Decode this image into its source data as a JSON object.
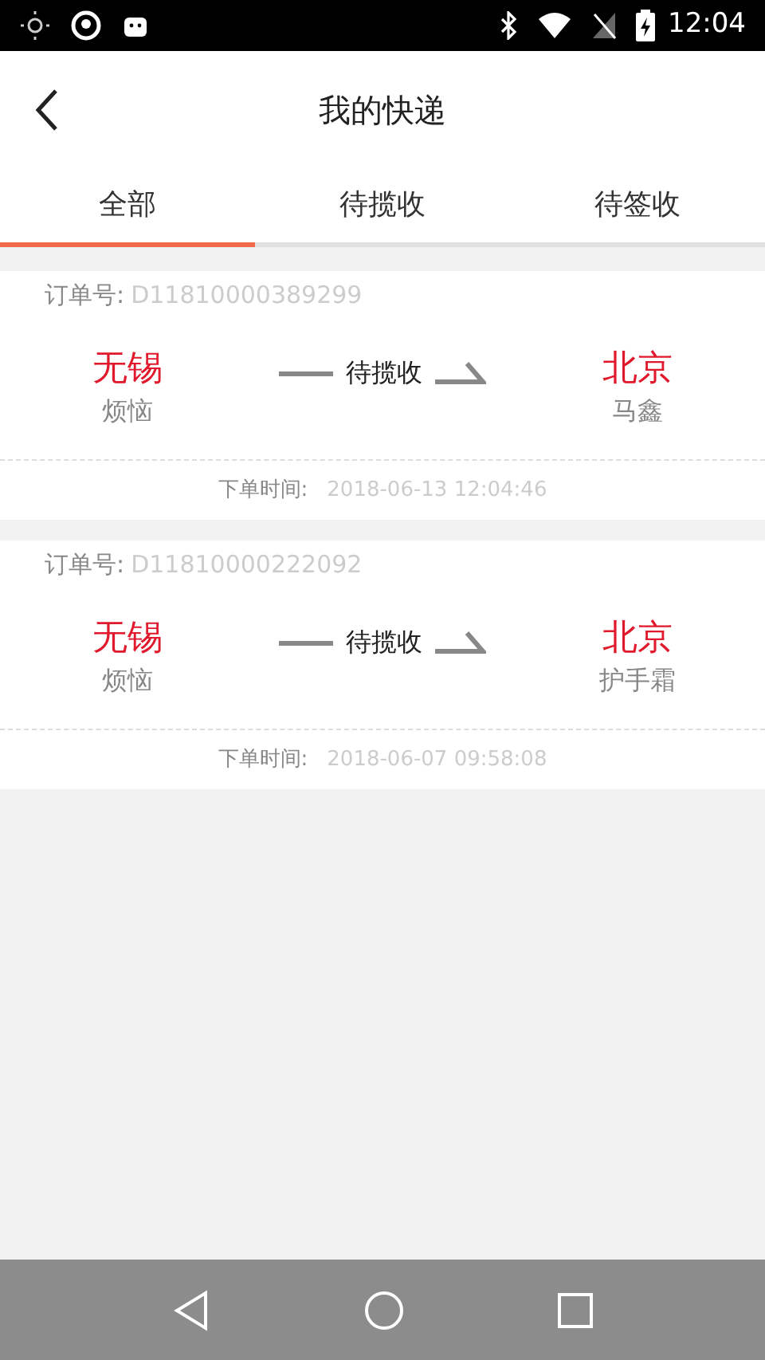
{
  "status_bar": {
    "time": "12:04"
  },
  "header": {
    "title": "我的快递"
  },
  "tabs": [
    {
      "label": "全部",
      "selected": true
    },
    {
      "label": "待揽收",
      "selected": false
    },
    {
      "label": "待签收",
      "selected": false
    }
  ],
  "orders": [
    {
      "order_label": "订单号:",
      "order_no": "D11810000389299",
      "from_city": "无锡",
      "from_name": "烦恼",
      "status": "待揽收",
      "to_city": "北京",
      "to_name": "马鑫",
      "time_label": "下单时间:",
      "time": "2018-06-13 12:04:46"
    },
    {
      "order_label": "订单号:",
      "order_no": "D11810000222092",
      "from_city": "无锡",
      "from_name": "烦恼",
      "status": "待揽收",
      "to_city": "北京",
      "to_name": "护手霜",
      "time_label": "下单时间:",
      "time": "2018-06-07 09:58:08"
    }
  ]
}
